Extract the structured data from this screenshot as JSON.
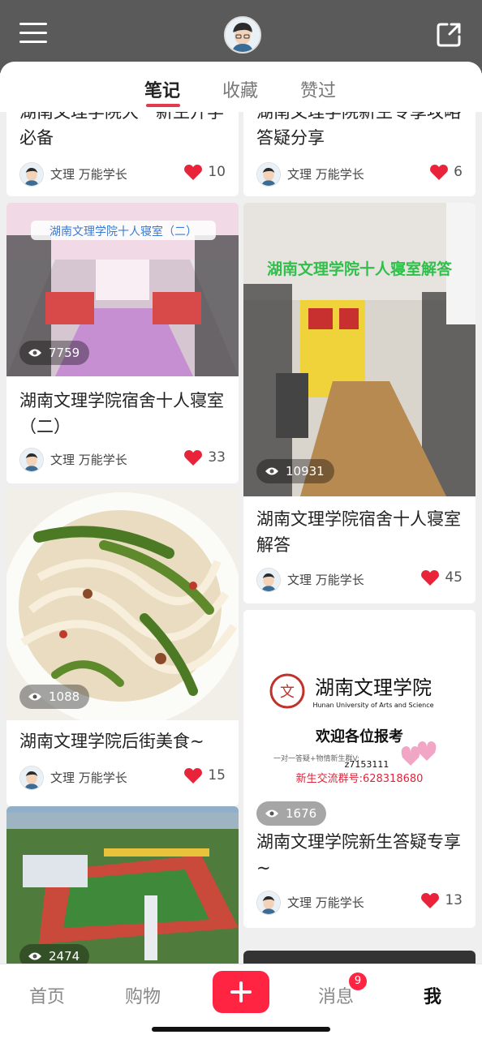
{
  "tabs": {
    "notes": "笔记",
    "favorites": "收藏",
    "liked": "赞过"
  },
  "author_name": "文理 万能学长",
  "cards": [
    {
      "title": "湖南文理学院大一新生开学必备",
      "likes": "10"
    },
    {
      "title": "湖南文理学院新生专享攻略答疑分享",
      "likes": "6"
    },
    {
      "title": "湖南文理学院宿舍十人寝室（二）",
      "views": "7759",
      "likes": "33",
      "image_text": "湖南文理学院十人寝室（二）"
    },
    {
      "title": "湖南文理学院宿舍十人寝室解答",
      "views": "10931",
      "likes": "45",
      "image_text": "湖南文理学院十人寝室解答"
    },
    {
      "title": "湖南文理学院后街美食~",
      "views": "1088",
      "likes": "15"
    },
    {
      "title": "湖南文理学院新生答疑专享~",
      "views": "1676",
      "likes": "13",
      "image_text": {
        "school_cn": "湖南文理学院",
        "school_en": "Hunan University of Arts and Science",
        "welcome": "欢迎各位报考",
        "slogan": "一对一答疑+物情新生群V:",
        "wechat": "z7153111",
        "group": "新生交流群号:628318680"
      }
    },
    {
      "views": "2474"
    }
  ],
  "bottom_nav": {
    "home": "首页",
    "shop": "购物",
    "messages": "消息",
    "messages_badge": "9",
    "me": "我"
  },
  "colors": {
    "accent": "#ff2442",
    "header_bg": "#5a5a5a",
    "like": "#e8233a"
  },
  "icons": [
    "menu-icon",
    "share-icon",
    "eye-icon",
    "heart-icon",
    "plus-icon"
  ]
}
